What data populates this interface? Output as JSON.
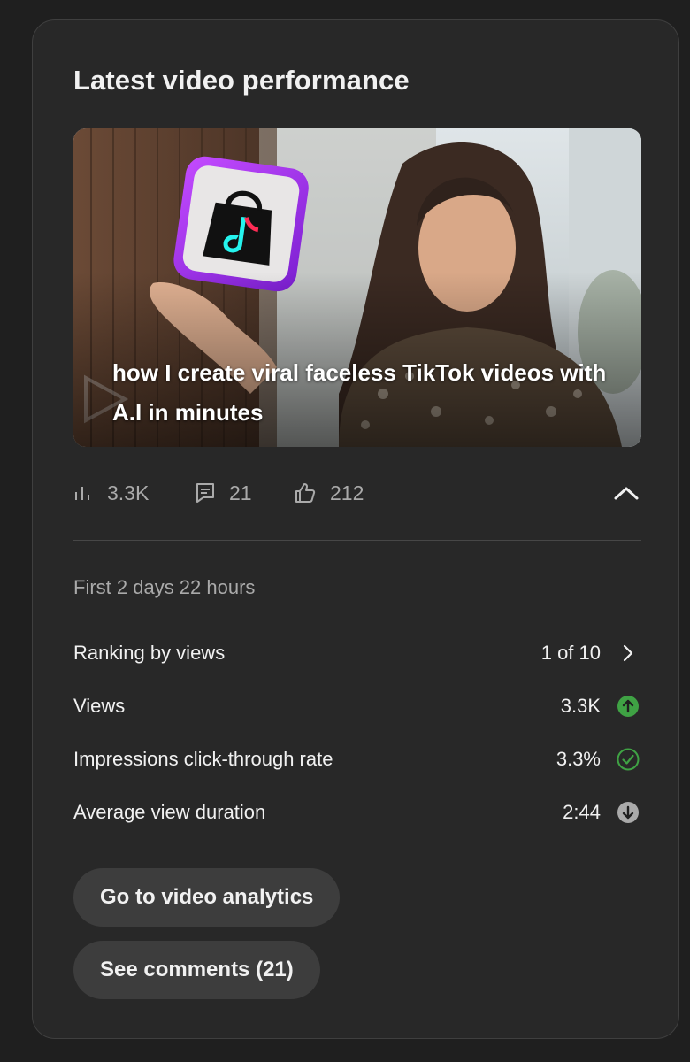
{
  "card": {
    "title": "Latest video performance"
  },
  "video": {
    "thumbnail_title": "how I create viral faceless TikTok videos with A.I in minutes"
  },
  "stats": {
    "views": "3.3K",
    "comments": "21",
    "likes": "212"
  },
  "period": "First 2 days 22 hours",
  "metrics": [
    {
      "label": "Ranking by views",
      "value": "1 of 10",
      "indicator": "chevron-right-icon"
    },
    {
      "label": "Views",
      "value": "3.3K",
      "indicator": "arrow-up-circle-icon"
    },
    {
      "label": "Impressions click-through rate",
      "value": "3.3%",
      "indicator": "check-circle-icon"
    },
    {
      "label": "Average view duration",
      "value": "2:44",
      "indicator": "arrow-down-circle-icon"
    }
  ],
  "buttons": {
    "analytics": "Go to video analytics",
    "comments": "See comments (21)"
  },
  "colors": {
    "background": "#1f1f1f",
    "card": "#282828",
    "positive": "#3fa244",
    "neutral": "#aaaaaa"
  }
}
